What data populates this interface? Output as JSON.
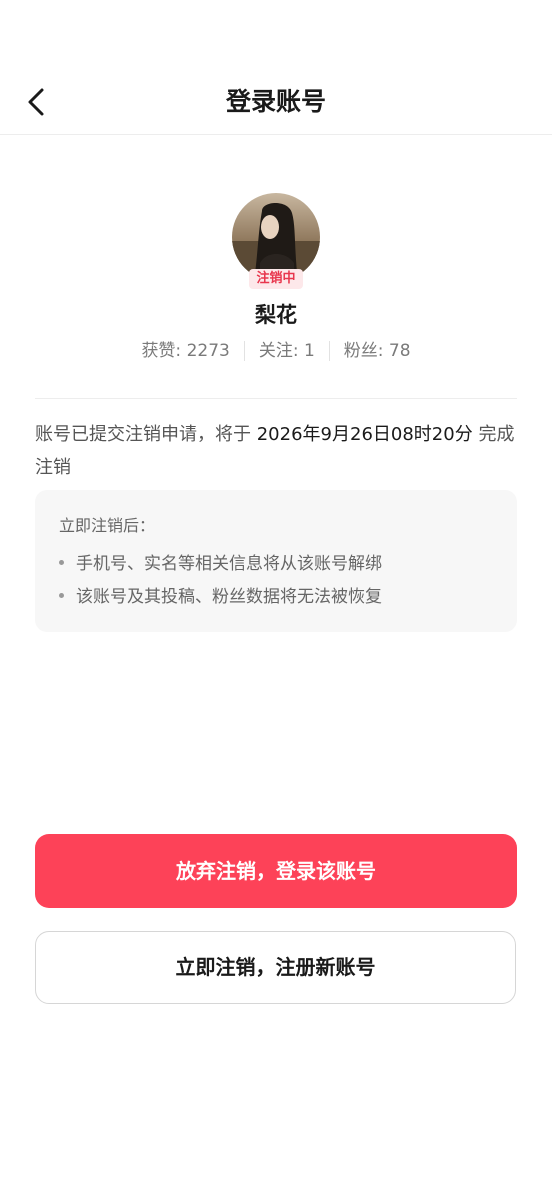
{
  "header": {
    "title": "登录账号",
    "back_icon": "chevron-left-icon"
  },
  "profile": {
    "avatar_icon": "avatar",
    "status_badge": "注销中",
    "name": "梨花",
    "stats": [
      {
        "label": "获赞: 2273"
      },
      {
        "label": "关注: 1"
      },
      {
        "label": "粉丝: 78"
      }
    ]
  },
  "notice": {
    "prefix": "账号已提交注销申请，将于 ",
    "date": "2026年9月26日08时20分",
    "suffix": " 完成注销"
  },
  "info_box": {
    "title": "立即注销后：",
    "items": [
      "手机号、实名等相关信息将从该账号解绑",
      "该账号及其投稿、粉丝数据将无法被恢复"
    ]
  },
  "actions": {
    "primary_label": "放弃注销，登录该账号",
    "secondary_label": "立即注销，注册新账号"
  },
  "colors": {
    "accent": "#fd4258",
    "badge_text": "#e8364d",
    "badge_bg": "#fde8ea"
  }
}
